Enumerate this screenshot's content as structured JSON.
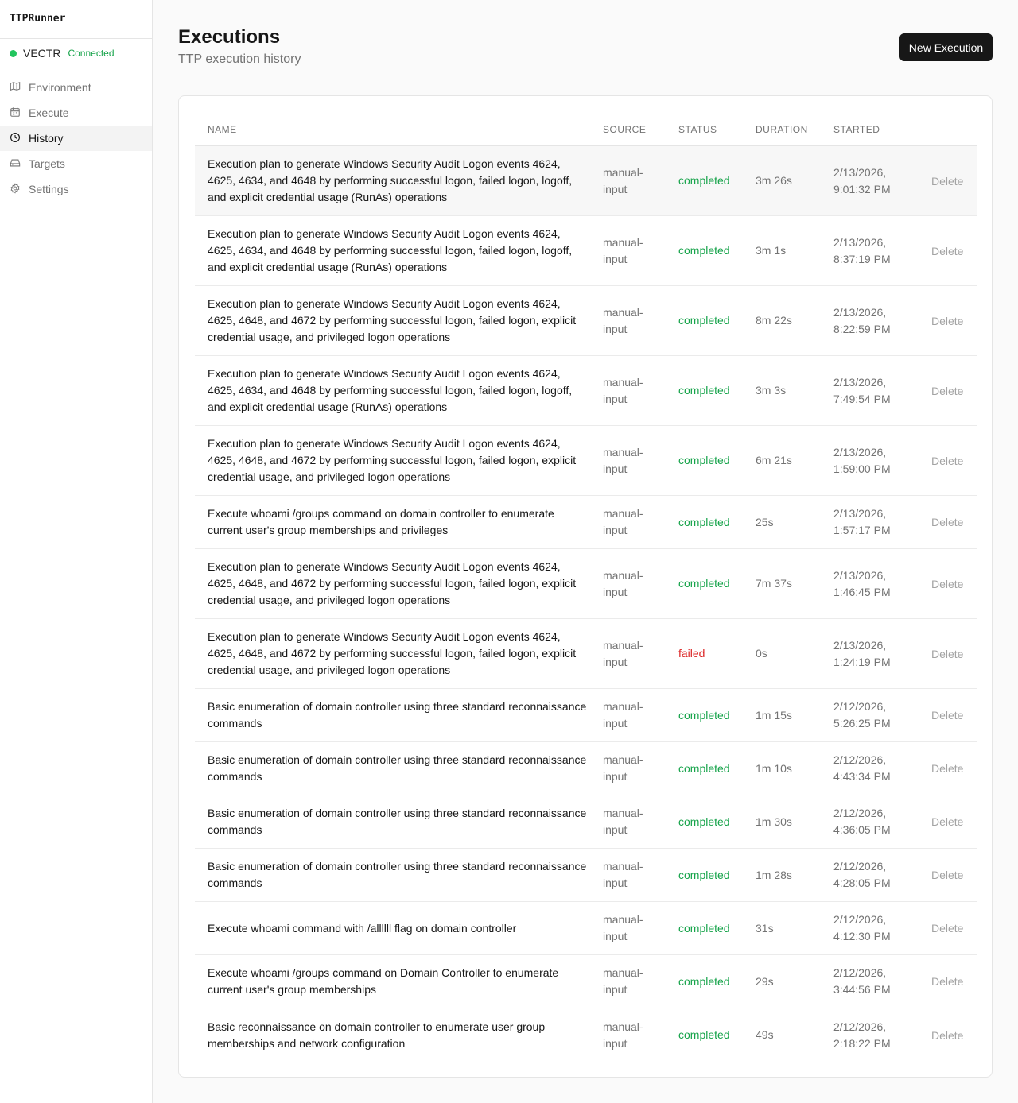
{
  "app": {
    "name": "TTPRunner",
    "connection": {
      "name": "VECTR",
      "status": "Connected"
    }
  },
  "nav": [
    {
      "label": "Environment",
      "icon": "map-icon"
    },
    {
      "label": "Execute",
      "icon": "calendar-icon"
    },
    {
      "label": "History",
      "icon": "clock-icon",
      "active": true
    },
    {
      "label": "Targets",
      "icon": "hard-drive-icon"
    },
    {
      "label": "Settings",
      "icon": "gear-icon"
    }
  ],
  "page": {
    "title": "Executions",
    "subtitle": "TTP execution history",
    "new_button": "New Execution"
  },
  "table": {
    "headers": {
      "name": "NAME",
      "source": "SOURCE",
      "status": "STATUS",
      "duration": "DURATION",
      "started": "STARTED"
    },
    "delete_label": "Delete",
    "rows": [
      {
        "name": "Execution plan to generate Windows Security Audit Logon events 4624, 4625, 4634, and 4648 by performing successful logon, failed logon, logoff, and explicit credential usage (RunAs) operations",
        "source": "manual-input",
        "status": "completed",
        "duration": "3m 26s",
        "started": "2/13/2026, 9:01:32 PM"
      },
      {
        "name": "Execution plan to generate Windows Security Audit Logon events 4624, 4625, 4634, and 4648 by performing successful logon, failed logon, logoff, and explicit credential usage (RunAs) operations",
        "source": "manual-input",
        "status": "completed",
        "duration": "3m 1s",
        "started": "2/13/2026, 8:37:19 PM"
      },
      {
        "name": "Execution plan to generate Windows Security Audit Logon events 4624, 4625, 4648, and 4672 by performing successful logon, failed logon, explicit credential usage, and privileged logon operations",
        "source": "manual-input",
        "status": "completed",
        "duration": "8m 22s",
        "started": "2/13/2026, 8:22:59 PM"
      },
      {
        "name": "Execution plan to generate Windows Security Audit Logon events 4624, 4625, 4634, and 4648 by performing successful logon, failed logon, logoff, and explicit credential usage (RunAs) operations",
        "source": "manual-input",
        "status": "completed",
        "duration": "3m 3s",
        "started": "2/13/2026, 7:49:54 PM"
      },
      {
        "name": "Execution plan to generate Windows Security Audit Logon events 4624, 4625, 4648, and 4672 by performing successful logon, failed logon, explicit credential usage, and privileged logon operations",
        "source": "manual-input",
        "status": "completed",
        "duration": "6m 21s",
        "started": "2/13/2026, 1:59:00 PM"
      },
      {
        "name": "Execute whoami /groups command on domain controller to enumerate current user's group memberships and privileges",
        "source": "manual-input",
        "status": "completed",
        "duration": "25s",
        "started": "2/13/2026, 1:57:17 PM"
      },
      {
        "name": "Execution plan to generate Windows Security Audit Logon events 4624, 4625, 4648, and 4672 by performing successful logon, failed logon, explicit credential usage, and privileged logon operations",
        "source": "manual-input",
        "status": "completed",
        "duration": "7m 37s",
        "started": "2/13/2026, 1:46:45 PM"
      },
      {
        "name": "Execution plan to generate Windows Security Audit Logon events 4624, 4625, 4648, and 4672 by performing successful logon, failed logon, explicit credential usage, and privileged logon operations",
        "source": "manual-input",
        "status": "failed",
        "duration": "0s",
        "started": "2/13/2026, 1:24:19 PM"
      },
      {
        "name": "Basic enumeration of domain controller using three standard reconnaissance commands",
        "source": "manual-input",
        "status": "completed",
        "duration": "1m 15s",
        "started": "2/12/2026, 5:26:25 PM"
      },
      {
        "name": "Basic enumeration of domain controller using three standard reconnaissance commands",
        "source": "manual-input",
        "status": "completed",
        "duration": "1m 10s",
        "started": "2/12/2026, 4:43:34 PM"
      },
      {
        "name": "Basic enumeration of domain controller using three standard reconnaissance commands",
        "source": "manual-input",
        "status": "completed",
        "duration": "1m 30s",
        "started": "2/12/2026, 4:36:05 PM"
      },
      {
        "name": "Basic enumeration of domain controller using three standard reconnaissance commands",
        "source": "manual-input",
        "status": "completed",
        "duration": "1m 28s",
        "started": "2/12/2026, 4:28:05 PM"
      },
      {
        "name": "Execute whoami command with /allllll flag on domain controller",
        "source": "manual-input",
        "status": "completed",
        "duration": "31s",
        "started": "2/12/2026, 4:12:30 PM"
      },
      {
        "name": "Execute whoami /groups command on Domain Controller to enumerate current user's group memberships",
        "source": "manual-input",
        "status": "completed",
        "duration": "29s",
        "started": "2/12/2026, 3:44:56 PM"
      },
      {
        "name": "Basic reconnaissance on domain controller to enumerate user group memberships and network configuration",
        "source": "manual-input",
        "status": "completed",
        "duration": "49s",
        "started": "2/12/2026, 2:18:22 PM"
      }
    ]
  },
  "colors": {
    "completed": "#16a34a",
    "failed": "#dc2626",
    "connected_dot": "#22c55e",
    "primary_button": "#171717"
  }
}
